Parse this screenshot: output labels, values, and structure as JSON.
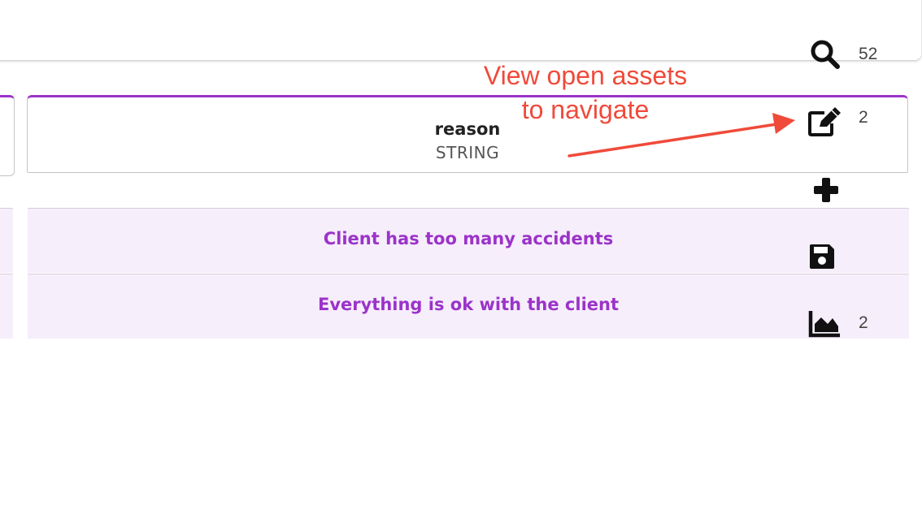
{
  "table": {
    "column": {
      "name": "reason",
      "type": "STRING"
    },
    "rows": [
      {
        "value": "Client has too many accidents"
      },
      {
        "value": "Everything is ok with the client"
      }
    ]
  },
  "annotation": {
    "line1": "View open assets",
    "line2": "to navigate",
    "color": "#f04a3a"
  },
  "toolbar": {
    "search": {
      "icon": "search-icon",
      "count": "52"
    },
    "edit": {
      "icon": "edit-icon",
      "count": "2"
    },
    "add": {
      "icon": "plus-icon"
    },
    "save": {
      "icon": "save-icon"
    },
    "chart": {
      "icon": "area-chart-icon",
      "count": "2"
    }
  },
  "colors": {
    "accent": "#9b33c9",
    "row_background": "#f6eefb"
  }
}
